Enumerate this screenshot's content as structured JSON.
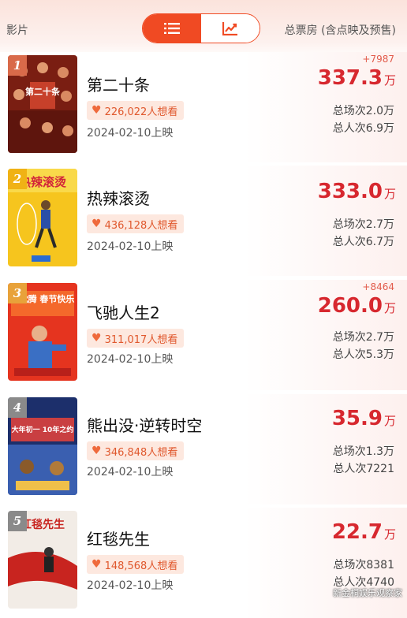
{
  "header": {
    "left_label": "影片",
    "right_label": "总票房 (含点映及预售)",
    "toggle": {
      "list_icon": "list-icon",
      "chart_icon": "trend-chart-icon"
    }
  },
  "colors": {
    "accent": "#f04a23",
    "box": "#d7282f",
    "want_bg": "#fde8df"
  },
  "movies": [
    {
      "rank": "1",
      "title": "第二十条",
      "want": "226,022人想看",
      "date": "2024-02-10上映",
      "increment": "+7987",
      "box_value": "337.3",
      "box_unit": "万",
      "sessions": "总场次2.0万",
      "admissions": "总人次6.9万",
      "poster_text": "第二十条",
      "poster_colors": [
        "#7a1e12",
        "#c7402a"
      ]
    },
    {
      "rank": "2",
      "title": "热辣滚烫",
      "want": "436,128人想看",
      "date": "2024-02-10上映",
      "increment": "",
      "box_value": "333.0",
      "box_unit": "万",
      "sessions": "总场次2.7万",
      "admissions": "总人次6.7万",
      "poster_text": "热辣滚烫",
      "poster_colors": [
        "#f6c51e",
        "#f9d94a"
      ]
    },
    {
      "rank": "3",
      "title": "飞驰人生2",
      "want": "311,017人想看",
      "date": "2024-02-10上映",
      "increment": "+8464",
      "box_value": "260.0",
      "box_unit": "万",
      "sessions": "总场次2.7万",
      "admissions": "总人次5.3万",
      "poster_text": "看沈腾 春节快乐",
      "poster_colors": [
        "#e5341f",
        "#f4682b"
      ]
    },
    {
      "rank": "4",
      "title": "熊出没·逆转时空",
      "want": "346,848人想看",
      "date": "2024-02-10上映",
      "increment": "",
      "box_value": "35.9",
      "box_unit": "万",
      "sessions": "总场次1.3万",
      "admissions": "总人次7221",
      "poster_text": "大年初一 10年之约",
      "poster_colors": [
        "#1c2f6b",
        "#3a5fb0"
      ]
    },
    {
      "rank": "5",
      "title": "红毯先生",
      "want": "148,568人想看",
      "date": "2024-02-10上映",
      "increment": "",
      "box_value": "22.7",
      "box_unit": "万",
      "sessions": "总场次8381",
      "admissions": "总人次4740",
      "poster_text": "红毯先生",
      "poster_colors": [
        "#f2ece6",
        "#c8241f"
      ]
    }
  ],
  "watermark": "新金桐娱乐观察家"
}
